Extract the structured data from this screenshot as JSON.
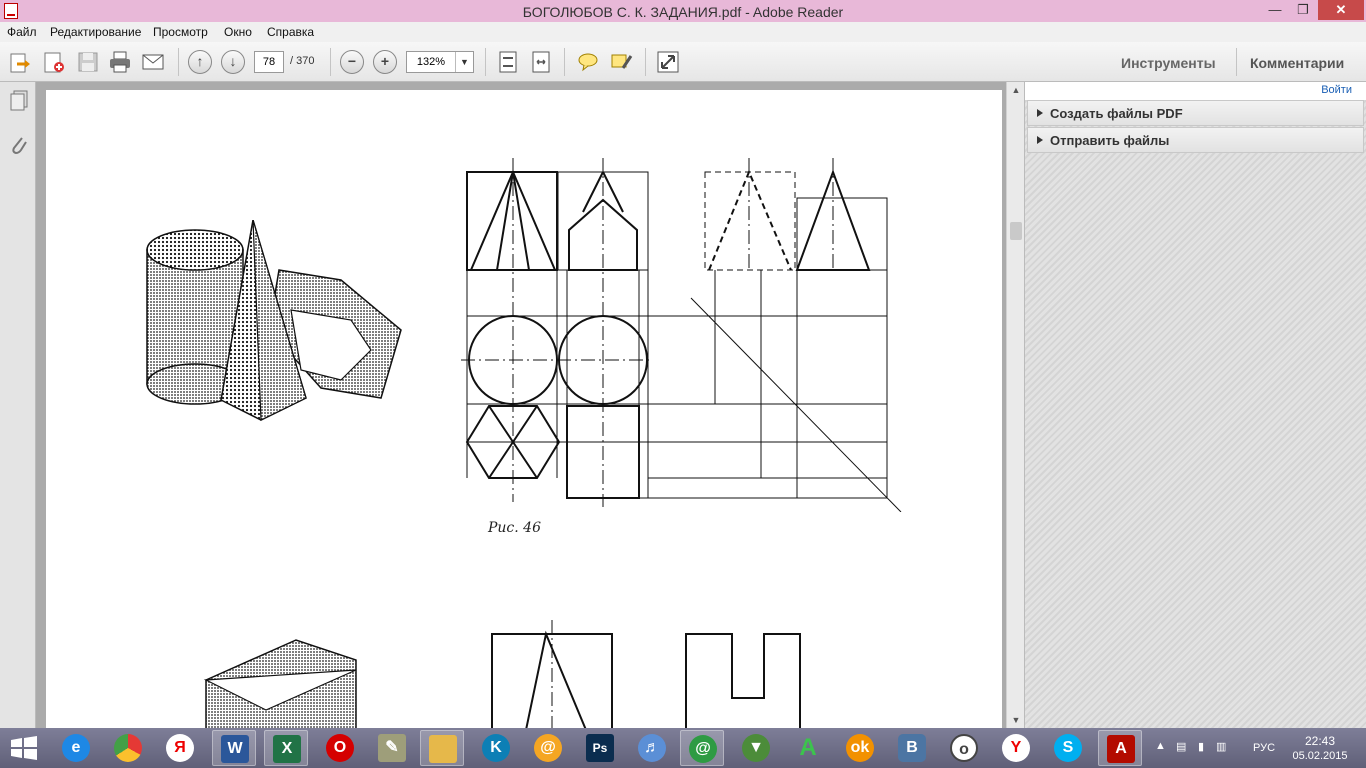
{
  "window": {
    "title": "БОГОЛЮБОВ С. К. ЗАДАНИЯ.pdf - Adobe Reader",
    "minimize_icon": "minimize-icon",
    "maximize_icon": "restore-icon",
    "close_icon": "close-icon"
  },
  "menu": [
    "Файл",
    "Редактирование",
    "Просмотр",
    "Окно",
    "Справка"
  ],
  "toolbar": {
    "current_page": "78",
    "total_pages": "/ 370",
    "zoom": "132%",
    "tools_label": "Инструменты",
    "comments_label": "Комментарии"
  },
  "right_panel": {
    "signin": "Войти",
    "sections": [
      "Создать файлы PDF",
      "Отправить файлы"
    ]
  },
  "document": {
    "figure_caption": "Рис. 46"
  },
  "taskbar": {
    "language": "РУС",
    "time": "22:43",
    "date": "05.02.2015",
    "apps": [
      "internet-explorer",
      "chrome",
      "yandex",
      "word",
      "excel",
      "opera",
      "scanner",
      "file-explorer",
      "kaspersky",
      "mail-agent",
      "photoshop",
      "volume",
      "icq",
      "download",
      "font-a",
      "odnoklassniki",
      "vkontakte",
      "circle-app",
      "yandex-browser",
      "skype",
      "adobe-reader"
    ]
  },
  "colors": {
    "titlebar": "#e8b8d8",
    "close": "#c74a4a",
    "taskbar": "#6e6e88",
    "link": "#1a5fb4"
  }
}
